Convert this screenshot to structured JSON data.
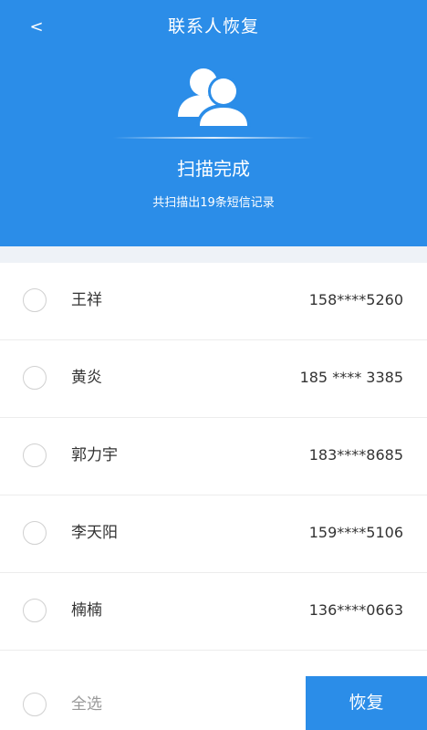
{
  "header": {
    "back_label": "<",
    "title": "联系人恢复",
    "icon": "contacts-icon",
    "status": "扫描完成",
    "summary": "共扫描出19条短信记录"
  },
  "contacts": [
    {
      "name": "王祥",
      "phone": "158****5260"
    },
    {
      "name": "黄炎",
      "phone": "185 **** 3385"
    },
    {
      "name": "郭力宇",
      "phone": "183****8685"
    },
    {
      "name": "李天阳",
      "phone": "159****5106"
    },
    {
      "name": "楠楠",
      "phone": "136****0663"
    }
  ],
  "footer": {
    "select_all_label": "全选",
    "restore_label": "恢复"
  },
  "colors": {
    "primary": "#2b8de8",
    "separator": "#eef2f7",
    "text": "#333333",
    "muted": "#999999"
  }
}
